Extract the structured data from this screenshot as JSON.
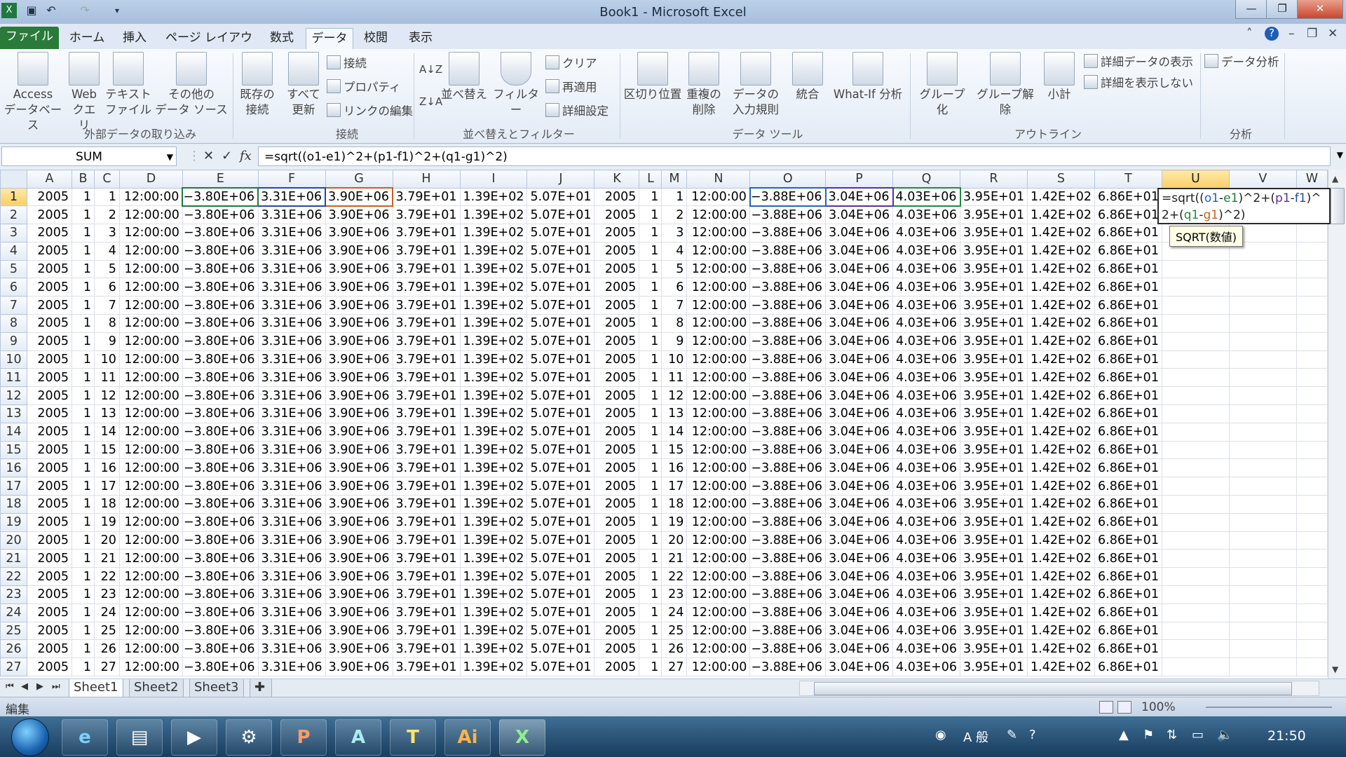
{
  "window": {
    "title": "Book1 - Microsoft Excel"
  },
  "ribbon_tabs": [
    "ファイル",
    "ホーム",
    "挿入",
    "ページ レイアウト",
    "数式",
    "データ",
    "校閲",
    "表示"
  ],
  "ribbon": {
    "ext_data": {
      "access": [
        "Access",
        "データベース"
      ],
      "web": [
        "Web",
        "クエリ"
      ],
      "text": [
        "テキスト",
        "ファイル"
      ],
      "other": [
        "その他の",
        "データ ソース"
      ],
      "group_label": "外部データの取り込み"
    },
    "connections": {
      "existing": [
        "既存の",
        "接続"
      ],
      "refresh_all": [
        "すべて",
        "更新"
      ],
      "conn": "接続",
      "props": "プロパティ",
      "edit_links": "リンクの編集",
      "group_label": "接続"
    },
    "sort_filter": {
      "sort": "並べ替え",
      "filter": "フィルター",
      "clear": "クリア",
      "reapply": "再適用",
      "advanced": "詳細設定",
      "group_label": "並べ替えとフィルター"
    },
    "data_tools": {
      "text_to_cols": "区切り位置",
      "remove_dup": [
        "重複の",
        "削除"
      ],
      "validation": [
        "データの",
        "入力規則"
      ],
      "consolidate": "統合",
      "whatif": "What-If 分析",
      "group_label": "データ ツール"
    },
    "outline": {
      "group": "グループ化",
      "ungroup": "グループ解除",
      "subtotal": "小計",
      "show_detail": "詳細データの表示",
      "hide_detail": "詳細を表示しない",
      "group_label": "アウトライン"
    },
    "analysis": {
      "data_analysis": "データ分析",
      "group_label": "分析"
    }
  },
  "formula_bar": {
    "name_box": "SUM",
    "fx": "fx",
    "formula": "=sqrt((o1-e1)^2+(p1-f1)^2+(q1-g1)^2)"
  },
  "edit_cell": {
    "line1": [
      "=sqrt((",
      "o1",
      "-",
      "e1",
      ")^2+(",
      "p1",
      "-",
      "f1",
      ")^"
    ],
    "line2": [
      "2+(",
      "q1",
      "-",
      "g1",
      ")^2)"
    ]
  },
  "tooltip": "SQRT(数値)",
  "columns": [
    "A",
    "B",
    "C",
    "D",
    "E",
    "F",
    "G",
    "H",
    "I",
    "J",
    "K",
    "L",
    "M",
    "N",
    "O",
    "P",
    "Q",
    "R",
    "S",
    "T",
    "U",
    "V",
    "W"
  ],
  "row_template": [
    "2005",
    "1",
    "{n}",
    "12:00:00",
    "−3.80E+06",
    "3.31E+06",
    "3.90E+06",
    "3.79E+01",
    "1.39E+02",
    "5.07E+01",
    "2005",
    "1",
    "{n}",
    "12:00:00",
    "−3.88E+06",
    "3.04E+06",
    "4.03E+06",
    "3.95E+01",
    "1.42E+02",
    "6.86E+01",
    "",
    "",
    ""
  ],
  "row_count": 27,
  "sheets": [
    "Sheet1",
    "Sheet2",
    "Sheet3"
  ],
  "status": {
    "mode": "編集",
    "zoom": "100%"
  },
  "taskbar": {
    "clock": "21:50",
    "ime": "A 般"
  }
}
